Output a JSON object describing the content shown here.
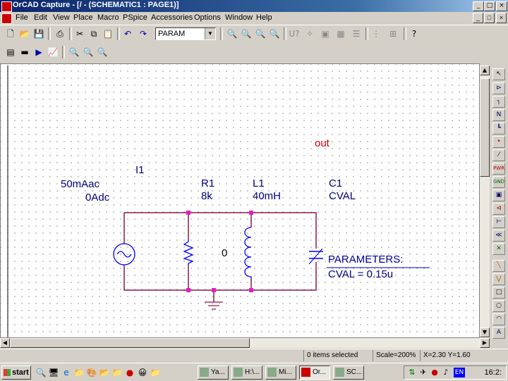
{
  "window": {
    "title": "OrCAD Capture - [/ - (SCHEMATIC1 : PAGE1)]",
    "caption_buttons": [
      "_",
      "□",
      "×"
    ],
    "mdi_buttons": [
      "_",
      "□",
      "×"
    ]
  },
  "menu": [
    "File",
    "Edit",
    "View",
    "Place",
    "Macro",
    "PSpice",
    "Accessories",
    "Options",
    "Window",
    "Help"
  ],
  "toolbar": {
    "part_select_value": "PARAM",
    "row1_icons": [
      "new-icon",
      "open-icon",
      "save-icon",
      "print-icon",
      "cut-icon",
      "copy-icon",
      "paste-icon",
      "undo-icon",
      "redo-icon",
      "zoom-in-icon",
      "zoom-out-icon",
      "zoom-area-icon",
      "zoom-all-icon",
      "help-query-icon",
      "annotate-icon",
      "drc-icon",
      "netlist-icon",
      "bom-icon",
      "crossref-icon",
      "project-manager-icon",
      "help-icon"
    ],
    "row2_icons": [
      "new-simulation-profile-icon",
      "edit-simulation-profile-icon",
      "run-simulation-icon",
      "view-simulation-results-icon",
      "voltage-marker-icon",
      "current-marker-icon",
      "power-marker-icon"
    ]
  },
  "schematic": {
    "net_label": "out",
    "source": {
      "name": "I1",
      "ac": "50mAac",
      "dc": "0Adc"
    },
    "resistor": {
      "name": "R1",
      "value": "8k"
    },
    "inductor": {
      "name": "L1",
      "value": "40mH"
    },
    "capacitor": {
      "name": "C1",
      "value": "CVAL"
    },
    "ground": {
      "label": "0"
    },
    "parameters": {
      "title": "PARAMETERS:",
      "line": "CVAL = 0.15u"
    }
  },
  "palette": [
    "select-tool",
    "place-part",
    "place-wire",
    "place-net-alias",
    "place-bus",
    "place-junction",
    "place-bus-entry",
    "place-power",
    "place-ground",
    "place-hierarchical-block",
    "place-port",
    "place-pin",
    "place-off-page-connector",
    "place-no-connect",
    "place-line",
    "place-polyline",
    "place-rectangle",
    "place-ellipse",
    "place-arc",
    "place-text"
  ],
  "statusbar": {
    "selection": "0 items selected",
    "scale": "Scale=200%",
    "coords": "X=2.30  Y=1.60"
  },
  "taskbar": {
    "start_label": "start",
    "quicklaunch": [
      "ql-1",
      "ql-2",
      "ql-3",
      "ql-4",
      "ql-5",
      "ql-6",
      "ql-7",
      "ql-8",
      "ql-9",
      "ql-10"
    ],
    "tasks": [
      "Ya...",
      "H:\\...",
      "Mi...",
      "Or...",
      "SC..."
    ],
    "active_task_index": 3,
    "lang": "EN",
    "clock": "16:2:"
  },
  "colors": {
    "wire": "#8b1a4a",
    "junction": "#e020c0",
    "part_body": "#0000ff",
    "net_label": "#cc0000",
    "text": "#000080",
    "parameters": "#0000a0",
    "titlebar": "#0a246a"
  }
}
